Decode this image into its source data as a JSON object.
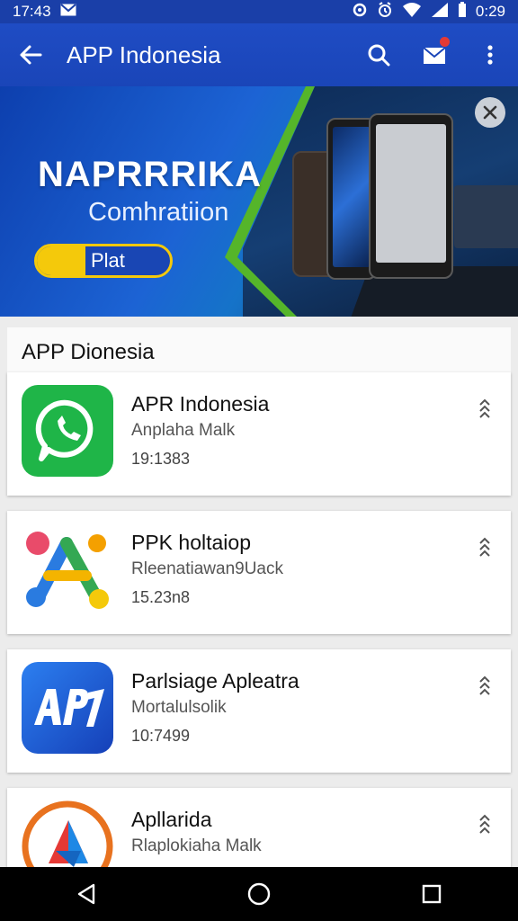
{
  "status_bar": {
    "time_left": "17:43",
    "time_right": "0:29"
  },
  "app_bar": {
    "title": "APP Indonesia"
  },
  "banner": {
    "title": "NAPRRRIKA",
    "subtitle": "Comhratiion",
    "play_label": "Plat"
  },
  "section": {
    "title": "APP Dionesia"
  },
  "apps": [
    {
      "name": "APR Indonesia",
      "subtitle": "Anplaha Malk",
      "number": "19:1383",
      "icon": "whatsapp-icon",
      "color": "#1fb548"
    },
    {
      "name": "PPK holtaiop",
      "subtitle": "Rleenatiawan9Uack",
      "number": "15.23n8",
      "icon": "multicolor-a-logo-icon",
      "color": "#ffffff"
    },
    {
      "name": "Parlsiage Apleatra",
      "subtitle": "Mortalulsolik",
      "number": "10:7499",
      "icon": "api-logo-icon",
      "color": "#1f5bd8"
    },
    {
      "name": "Apllarida",
      "subtitle": "Rlaplokiaha Malk",
      "number": "",
      "icon": "play-triangle-icon",
      "color": "#ffffff"
    }
  ],
  "colors": {
    "app_bar": "#1f4cc4",
    "accent_green": "#55b52a",
    "accent_yellow": "#f4c90b"
  }
}
